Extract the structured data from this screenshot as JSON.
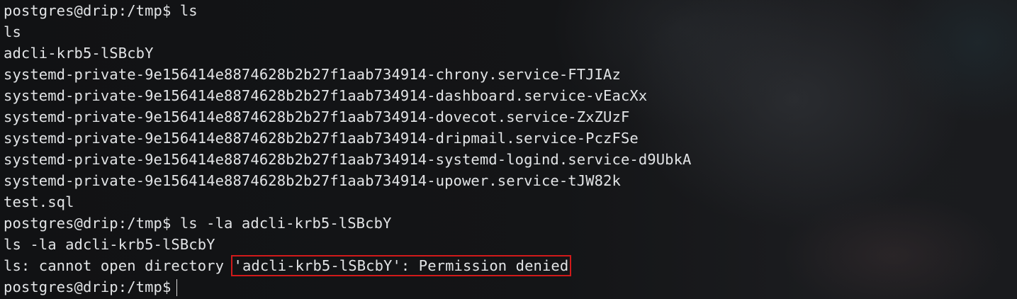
{
  "terminal": {
    "lines": [
      "postgres@drip:/tmp$ ls",
      "ls",
      "adcli-krb5-lSBcbY",
      "systemd-private-9e156414e8874628b2b27f1aab734914-chrony.service-FTJIAz",
      "systemd-private-9e156414e8874628b2b27f1aab734914-dashboard.service-vEacXx",
      "systemd-private-9e156414e8874628b2b27f1aab734914-dovecot.service-ZxZUzF",
      "systemd-private-9e156414e8874628b2b27f1aab734914-dripmail.service-PczFSe",
      "systemd-private-9e156414e8874628b2b27f1aab734914-systemd-logind.service-d9UbkA",
      "systemd-private-9e156414e8874628b2b27f1aab734914-upower.service-tJW82k",
      "test.sql",
      "postgres@drip:/tmp$ ls -la adcli-krb5-lSBcbY",
      "ls -la adcli-krb5-lSBcbY"
    ],
    "error_prefix": "ls: cannot open directory ",
    "error_highlighted": "'adcli-krb5-lSBcbY': Permission denied",
    "prompt": "postgres@drip:/tmp$"
  },
  "colors": {
    "text": "#e2e4e6",
    "highlight_box": "#d11a1a"
  }
}
